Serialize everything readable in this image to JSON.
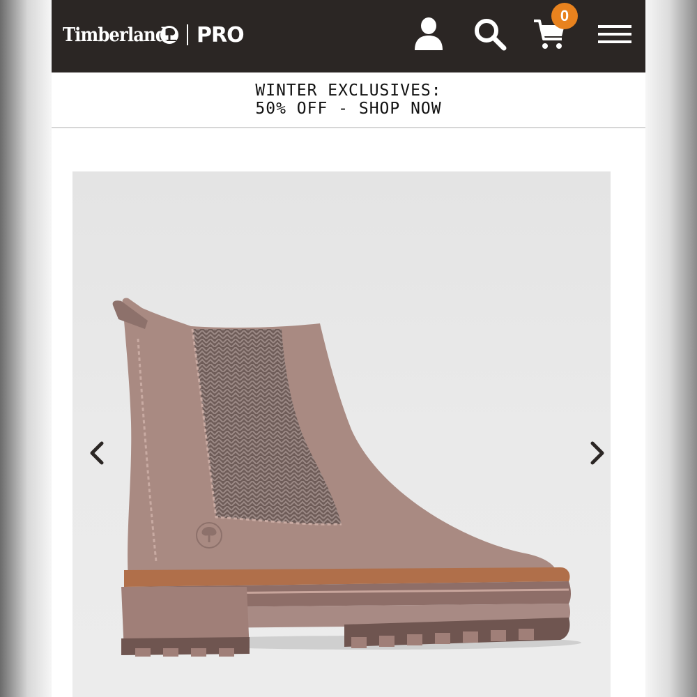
{
  "header": {
    "brand_name": "Timberland",
    "pro_label": "PRO",
    "cart_count": "0",
    "icons": [
      "tree-logo-icon",
      "account-icon",
      "search-icon",
      "cart-icon",
      "menu-icon"
    ]
  },
  "promo": {
    "line1": "WINTER EXCLUSIVES:",
    "line2": "50% OFF - SHOP NOW"
  },
  "carousel": {
    "prev_icon": "chevron-left-icon",
    "next_icon": "chevron-right-icon"
  },
  "colors": {
    "header_bg": "#2b2624",
    "badge": "#e8821e",
    "boot": "#a78880"
  }
}
